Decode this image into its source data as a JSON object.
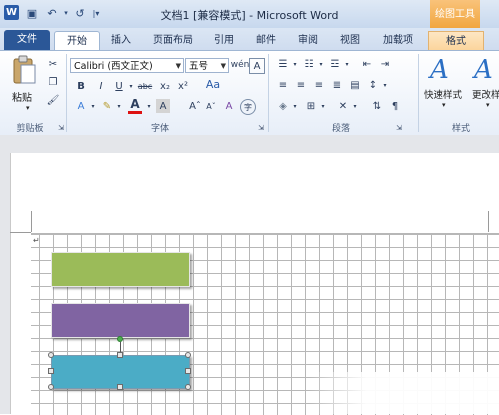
{
  "window": {
    "title": "文档1 [兼容模式] - Microsoft Word",
    "context_tab_title": "绘图工具"
  },
  "quick_access": {
    "app_icon_glyph": "W",
    "save_glyph": "▣",
    "undo_glyph": "↶",
    "redo_glyph": "↺"
  },
  "tabs": [
    "文件",
    "开始",
    "插入",
    "页面布局",
    "引用",
    "邮件",
    "审阅",
    "视图",
    "加载项",
    "格式"
  ],
  "ribbon": {
    "clipboard": {
      "paste_label": "粘贴",
      "group_label": "剪贴板"
    },
    "font": {
      "font_name": "Calibri (西文正文)",
      "font_size": "五号",
      "group_label": "字体",
      "bold": "B",
      "italic": "I",
      "underline": "U",
      "strike": "abc",
      "subscript": "x₂",
      "superscript": "x²",
      "font_color": "A",
      "grow": "Aˆ",
      "shrink": "Aˇ",
      "phonetic": "wén",
      "clear": "A",
      "char_border": "A",
      "enclose": "字"
    },
    "paragraph": {
      "group_label": "段落"
    },
    "styles": {
      "quick_styles_label": "快速样式",
      "change_styles_label": "更改样式",
      "group_label": "样式"
    }
  },
  "document": {
    "paragraph_mark": "↵"
  },
  "shapes": [
    {
      "name": "green-rectangle",
      "color": "#9bbb59"
    },
    {
      "name": "purple-rectangle",
      "color": "#8064a2"
    },
    {
      "name": "blue-rectangle",
      "color": "#4bacc6",
      "selected": true
    }
  ],
  "colors": {
    "file_tab": "#2b5797",
    "rotation_handle": "#4caf50"
  }
}
